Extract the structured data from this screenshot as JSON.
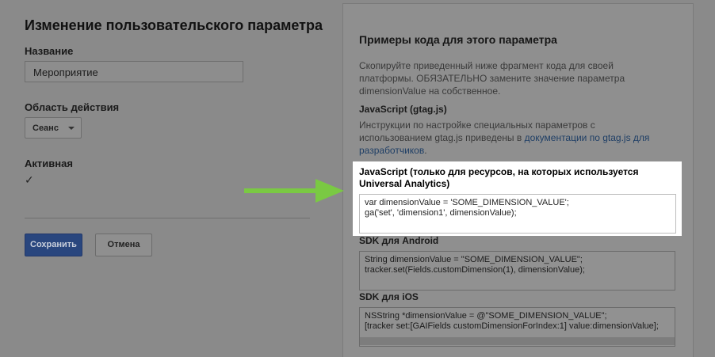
{
  "form": {
    "title": "Изменение пользовательского параметра",
    "name_label": "Название",
    "name_value": "Мероприятие",
    "scope_label": "Область действия",
    "scope_value": "Сеанс",
    "active_label": "Активная",
    "active_checked": true,
    "check_glyph": "✓",
    "save_label": "Сохранить",
    "cancel_label": "Отмена"
  },
  "panel": {
    "title": "Примеры кода для этого параметра",
    "description": "Скопируйте приведенный ниже фрагмент кода для своей платформы. ОБЯЗАТЕЛЬНО замените значение параметра dimensionValue на собственное.",
    "gtag_heading": "JavaScript (gtag.js)",
    "gtag_text": "Инструкции по настройке специальных параметров с использованием gtag.js приведены в ",
    "gtag_link": "документации по gtag.js для разработчиков",
    "gtag_text_end": ".",
    "ua_heading": "JavaScript (только для ресурсов, на которых используется Universal Analytics)",
    "ua_code": "var dimensionValue = 'SOME_DIMENSION_VALUE';\nga('set', 'dimension1', dimensionValue);",
    "android_heading": "SDK для Android",
    "android_code": "String dimensionValue = \"SOME_DIMENSION_VALUE\";\ntracker.set(Fields.customDimension(1), dimensionValue);",
    "ios_heading": "SDK для iOS",
    "ios_code": "NSString *dimensionValue = @\"SOME_DIMENSION_VALUE\";\n[tracker set:[GAIFields customDimensionForIndex:1] value:dimensionValue];"
  },
  "colors": {
    "highlight_arrow": "#7ac943",
    "save_button": "#29467e",
    "overlay": "#8a8a8a"
  },
  "icons": [
    "chevron-down-icon",
    "checkmark-icon",
    "arrow-right-icon"
  ]
}
